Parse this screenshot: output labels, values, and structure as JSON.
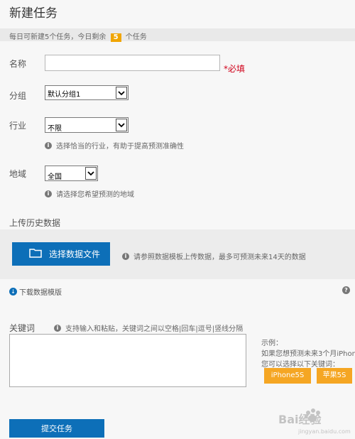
{
  "page": {
    "title": "新建任务"
  },
  "quota": {
    "prefix": "每日可新建5个任务，今日剩余",
    "count": "5",
    "suffix": "个任务"
  },
  "form": {
    "name": {
      "label": "名称",
      "value": "",
      "required": "*必填"
    },
    "group": {
      "label": "分组",
      "selected": "默认分组1"
    },
    "industry": {
      "label": "行业",
      "selected": "不限",
      "hint": "选择恰当的行业，有助于提高预测准确性"
    },
    "region": {
      "label": "地域",
      "selected": "全国",
      "hint": "请选择您希望预测的地域"
    }
  },
  "upload": {
    "section_title": "上传历史数据",
    "button_label": "选择数据文件",
    "hint": "请参照数据模板上传数据，最多可预测未来14天的数据",
    "download_link": "下载数据模版"
  },
  "keywords": {
    "label": "关键词",
    "hint": "支持输入和粘贴，关键词之间以空格|回车|逗号|竖线分隔",
    "value": "",
    "example_title": "示例：",
    "example_line1": "如果您想预测未来3个月iPhon",
    "example_line2": "您可以选择以下关键词：",
    "tags": [
      "iPhone5S",
      "苹果5S"
    ]
  },
  "submit": {
    "label": "提交任务"
  },
  "watermark": {
    "text": "Bai经验",
    "sub": "jingyan.baidu.com"
  },
  "colors": {
    "primary": "#0d6fb8",
    "accent": "#f5a623",
    "required": "#d0021b"
  },
  "icons": {
    "info": "info-icon",
    "folder": "folder-icon",
    "download": "download-icon",
    "help": "help-icon",
    "chevron": "chevron-down-icon"
  }
}
